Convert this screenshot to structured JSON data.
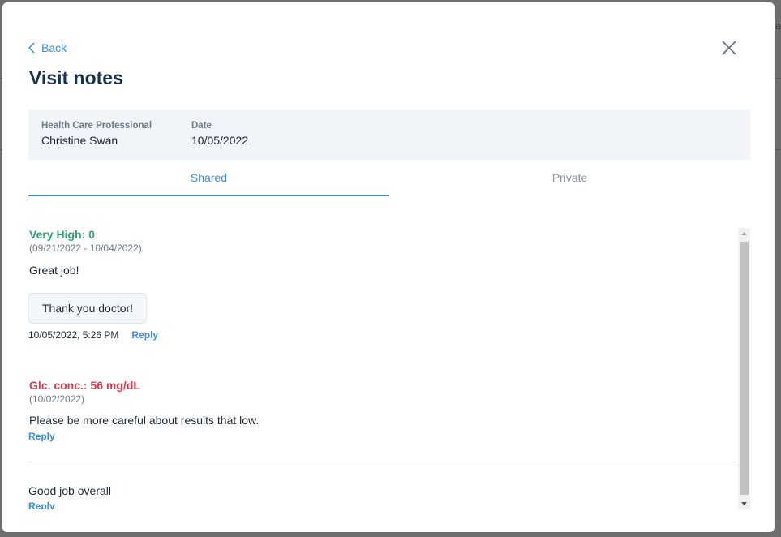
{
  "modal": {
    "back_label": "Back",
    "title": "Visit notes",
    "info": {
      "hcp_label": "Health Care Professional",
      "hcp_value": "Christine Swan",
      "date_label": "Date",
      "date_value": "10/05/2022"
    },
    "tabs": [
      {
        "label": "Shared",
        "active": true
      },
      {
        "label": "Private",
        "active": false
      }
    ],
    "notes": [
      {
        "title": "Very High: 0",
        "range": "(09/21/2022 - 10/04/2022)",
        "body": "Great job!",
        "reply_text": "Thank you doctor!",
        "timestamp": "10/05/2022, 5:26 PM",
        "reply_label": "Reply"
      },
      {
        "title": "Glc. conc.: 56 mg/dL",
        "range": "(10/02/2022)",
        "body": "Please be more careful about results that low.",
        "reply_label": "Reply"
      },
      {
        "body": "Good job overall",
        "reply_label": "Reply"
      }
    ]
  },
  "colors": {
    "accent": "#3a8ee0",
    "title": "#16324f",
    "status_green": "#2aa471",
    "status_red": "#e0384a"
  }
}
